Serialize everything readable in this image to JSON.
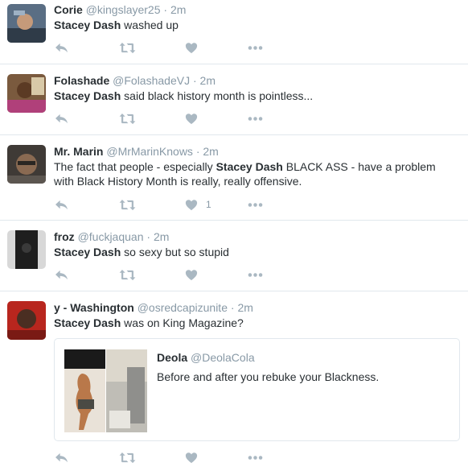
{
  "colors": {
    "icon": "#aab8c2",
    "muted": "#8899a6",
    "text": "#292f33",
    "divider": "#e1e8ed"
  },
  "icons": [
    "reply-icon",
    "retweet-icon",
    "heart-icon",
    "more-icon"
  ],
  "tweets": [
    {
      "name": "Corie",
      "handle": "@kingslayer25",
      "dot": "·",
      "time": "2m",
      "highlight": "Stacey Dash",
      "text_after": " washed up",
      "likes": ""
    },
    {
      "name": "Folashade",
      "handle": "@FolashadeVJ",
      "dot": "·",
      "time": "2m",
      "highlight": "Stacey Dash",
      "text_after": " said black history month is pointless...",
      "likes": ""
    },
    {
      "name": "Mr. Marin",
      "handle": "@MrMarinKnows",
      "dot": "·",
      "time": "2m",
      "text_before": "The fact that people - especially ",
      "highlight": "Stacey Dash",
      "text_after": " BLACK ASS - have a problem with Black History Month is really, really offensive.",
      "likes": "1"
    },
    {
      "name": "froz",
      "handle": "@fuckjaquan",
      "dot": "·",
      "time": "2m",
      "highlight": "Stacey Dash",
      "text_after": " so sexy but so stupid",
      "likes": ""
    },
    {
      "name": "y - Washington",
      "handle": "@osredcapizunite",
      "dot": "·",
      "time": "2m",
      "highlight": "Stacey Dash",
      "text_after": " was on King Magazine?",
      "likes": "",
      "quote": {
        "name": "Deola",
        "handle": "@DeolaCola",
        "text": "Before and after you rebuke your Blackness."
      }
    }
  ]
}
